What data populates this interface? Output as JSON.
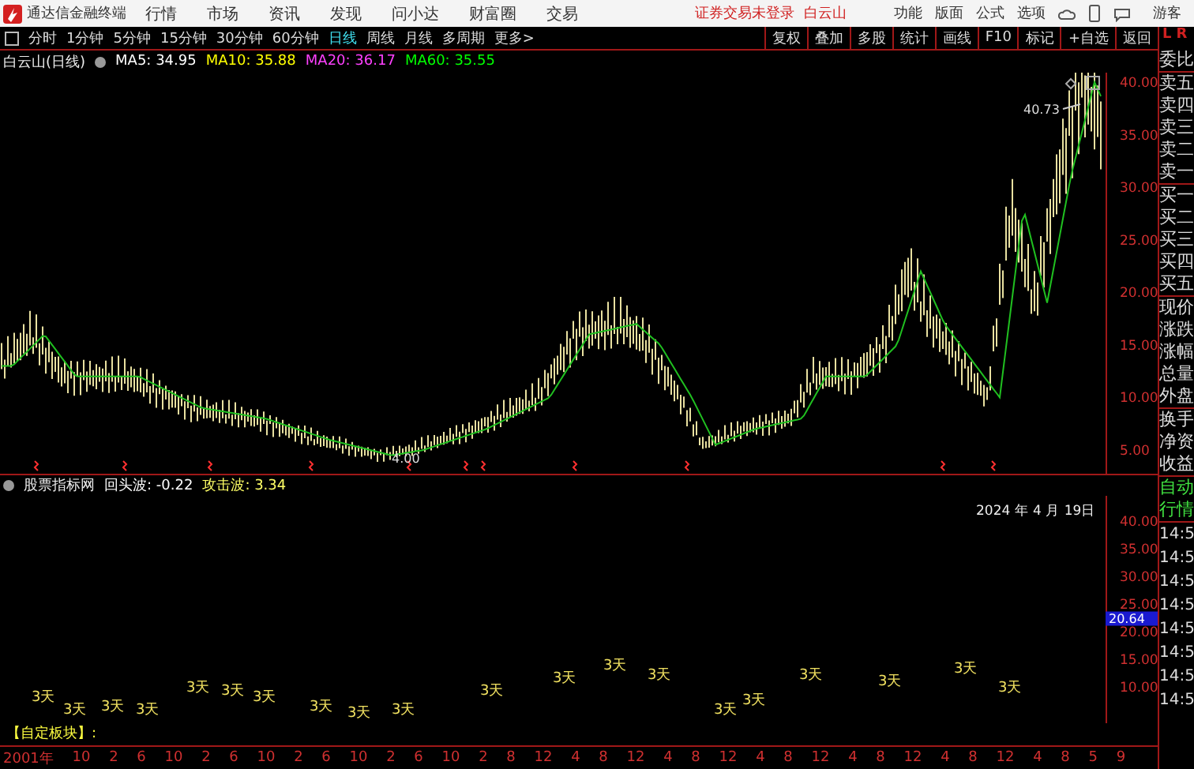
{
  "title_bar": {
    "app_name": "通达信金融终端",
    "menu": [
      "行情",
      "市场",
      "资讯",
      "发现",
      "问小达",
      "财富圈",
      "交易"
    ],
    "login_status": "证券交易未登录",
    "stock": "白云山",
    "right_menu": [
      "功能",
      "版面",
      "公式",
      "选项"
    ],
    "user": "游客"
  },
  "period_tabs": [
    {
      "label": "分时",
      "selected": false
    },
    {
      "label": "1分钟",
      "selected": false
    },
    {
      "label": "5分钟",
      "selected": false
    },
    {
      "label": "15分钟",
      "selected": false
    },
    {
      "label": "30分钟",
      "selected": false
    },
    {
      "label": "60分钟",
      "selected": false
    },
    {
      "label": "日线",
      "selected": true
    },
    {
      "label": "周线",
      "selected": false
    },
    {
      "label": "月线",
      "selected": false
    },
    {
      "label": "多周期",
      "selected": false
    },
    {
      "label": "更多>",
      "selected": false
    }
  ],
  "tools": [
    "复权",
    "叠加",
    "多股",
    "统计",
    "画线",
    "F10",
    "标记",
    "+自选",
    "返回"
  ],
  "main_chart": {
    "title": "白云山(日线)",
    "ma": [
      {
        "label": "MA5: 34.95",
        "color": "#ffffff"
      },
      {
        "label": "MA10: 35.88",
        "color": "#ffff00"
      },
      {
        "label": "MA20: 36.17",
        "color": "#ff40ff"
      },
      {
        "label": "MA60: 35.55",
        "color": "#00ff00"
      }
    ],
    "price_axis": [
      "40.00",
      "35.00",
      "30.00",
      "25.00",
      "20.00",
      "15.00",
      "10.00",
      "5.00"
    ],
    "high_label": "40.73",
    "low_label": "4.00"
  },
  "indicator": {
    "name": "股票指标网",
    "values": [
      {
        "label": "回头波: -0.22",
        "color": "#ffffff"
      },
      {
        "label": "攻击波: 3.34",
        "color": "#ffff66"
      }
    ],
    "date": "2024 年 4 月 19日",
    "axis": [
      "40.00",
      "35.00",
      "30.00",
      "25.00",
      "20.00",
      "15.00",
      "10.00"
    ],
    "current_value": "20.64",
    "marks": [
      "3天",
      "3天",
      "3天",
      "3天",
      "3天",
      "3天",
      "3天",
      "3天",
      "3天",
      "3天",
      "3天",
      "3天",
      "3天",
      "3天",
      "3天",
      "3天",
      "3天",
      "3天",
      "3天",
      "3天"
    ]
  },
  "custom_block": "【自定板块】:",
  "time_axis": [
    "2001年",
    "10",
    "2",
    "6",
    "10",
    "2",
    "6",
    "10",
    "2",
    "6",
    "10",
    "2",
    "6",
    "10",
    "2",
    "8",
    "12",
    "4",
    "8",
    "12",
    "4",
    "8",
    "12",
    "4",
    "8",
    "12",
    "4",
    "8",
    "12",
    "4",
    "8",
    "12",
    "4",
    "8",
    "5",
    "9"
  ],
  "side_panel": {
    "header": [
      "L",
      "R"
    ],
    "quote_groups": [
      [
        "委比"
      ],
      [
        "卖五",
        "卖四",
        "卖三",
        "卖二",
        "卖一"
      ],
      [
        "买一",
        "买二",
        "买三",
        "买四",
        "买五"
      ],
      [
        "现价",
        "涨跌",
        "涨幅",
        "总量",
        "外盘"
      ],
      [
        "换手",
        "净资",
        "收益"
      ]
    ],
    "tabs": [
      "自动",
      "行情"
    ],
    "times": [
      "14:5",
      "14:5",
      "14:5",
      "14:5",
      "14:5",
      "14:5",
      "14:5",
      "14:5"
    ]
  }
}
